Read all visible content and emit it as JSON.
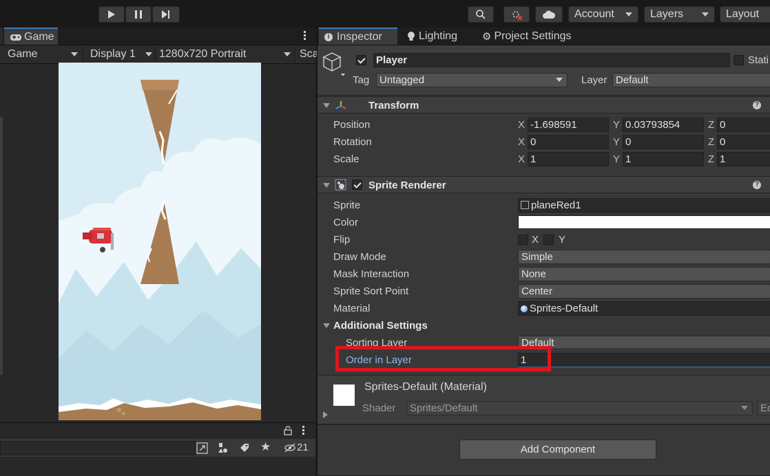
{
  "toolbar": {
    "account_label": "Account",
    "layers_label": "Layers",
    "layout_label": "Layout"
  },
  "game_panel": {
    "tab_label": "Game",
    "mode_label": "Game",
    "display_label": "Display 1",
    "resolution_label": "1280x720 Portrait",
    "scale_label": "Sca"
  },
  "bottom_panel": {
    "hidden_count": "21"
  },
  "inspector": {
    "tabs": [
      {
        "label": "Inspector"
      },
      {
        "label": "Lighting"
      },
      {
        "label": "Project Settings"
      }
    ],
    "object": {
      "name": "Player",
      "static_label": "Stati",
      "tag_label": "Tag",
      "tag_value": "Untagged",
      "layer_label": "Layer",
      "layer_value": "Default"
    },
    "transform": {
      "title": "Transform",
      "position_label": "Position",
      "rotation_label": "Rotation",
      "scale_label": "Scale",
      "axis_x": "X",
      "axis_y": "Y",
      "axis_z": "Z",
      "position": {
        "x": "-1.698591",
        "y": "0.03793854",
        "z": "0"
      },
      "rotation": {
        "x": "0",
        "y": "0",
        "z": "0"
      },
      "scale": {
        "x": "1",
        "y": "1",
        "z": "1"
      }
    },
    "sprite_renderer": {
      "title": "Sprite Renderer",
      "sprite_label": "Sprite",
      "sprite_value": "planeRed1",
      "color_label": "Color",
      "color_value": "#ffffff",
      "flip_label": "Flip",
      "flip_x": "X",
      "flip_y": "Y",
      "draw_mode_label": "Draw Mode",
      "draw_mode_value": "Simple",
      "mask_label": "Mask Interaction",
      "mask_value": "None",
      "sort_point_label": "Sprite Sort Point",
      "sort_point_value": "Center",
      "material_label": "Material",
      "material_value": "Sprites-Default",
      "additional_label": "Additional Settings",
      "sorting_layer_label": "Sorting Layer",
      "sorting_layer_value": "Default",
      "order_label": "Order in Layer",
      "order_value": "1"
    },
    "material": {
      "title": "Sprites-Default (Material)",
      "shader_label": "Shader",
      "shader_value": "Sprites/Default",
      "edit_label": "Ec"
    },
    "add_component_label": "Add Component"
  },
  "colors": {
    "highlight": "#e0141e",
    "accent": "#3a79bb",
    "sky": "#d8ecf5"
  }
}
